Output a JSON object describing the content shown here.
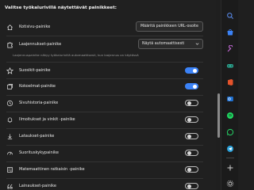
{
  "settings": {
    "heading": "Valitse työkalurivillä näytettävät painikkeet:",
    "home": {
      "label": "Kotisivu-painike",
      "button": "Määritä painikkeen URL-osoite"
    },
    "extensions": {
      "label": "Laajennukset-painike",
      "select_value": "Näytä automaattisesti",
      "description": "Laajennuspainike näkyy työkalurivillä automaattisesti, kun laajennus on käytössä"
    },
    "items": [
      {
        "label": "Suosikit-painike",
        "icon": "star-icon",
        "enabled": true
      },
      {
        "label": "Kokoelmat-painike",
        "icon": "collections-icon",
        "enabled": true
      },
      {
        "label": "Sivuhistoria-painike",
        "icon": "history-icon",
        "enabled": false
      },
      {
        "label": "Ilmoitukset ja vinkit -painike",
        "icon": "bell-icon",
        "enabled": false
      },
      {
        "label": "Lataukset-painike",
        "icon": "download-icon",
        "enabled": false
      },
      {
        "label": "Suorituskykypainike",
        "icon": "performance-icon",
        "enabled": false
      },
      {
        "label": "Matemaattinen ratkaisin -painike",
        "icon": "math-icon",
        "enabled": false
      },
      {
        "label": "Lainaukset-painike",
        "icon": "quote-icon",
        "enabled": false
      }
    ]
  },
  "sidebar": {
    "icons": [
      "search-icon",
      "shopping-icon",
      "tools-icon",
      "games-icon",
      "office-icon",
      "outlook-icon",
      "spotify-icon",
      "whatsapp-icon",
      "telegram-icon",
      "add-icon",
      "customize-icon"
    ]
  },
  "colors": {
    "accent": "#3b82f6",
    "background": "#202020"
  }
}
